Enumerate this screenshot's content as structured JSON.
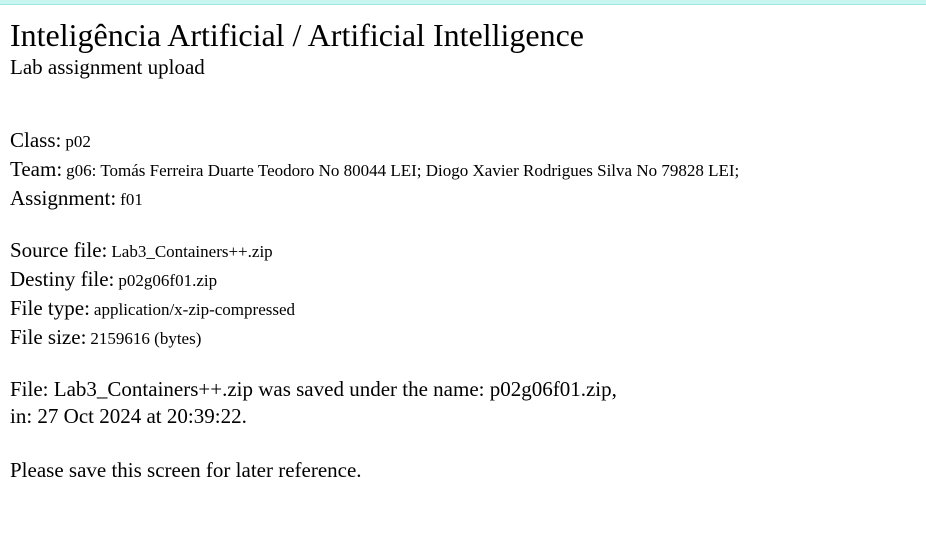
{
  "header": {
    "title": "Inteligência Artificial / Artificial Intelligence",
    "subtitle": "Lab assignment upload"
  },
  "details": {
    "class_label": "Class:",
    "class_value": "p02",
    "team_label": "Team:",
    "team_value": "g06: Tomás Ferreira Duarte Teodoro No 80044 LEI; Diogo Xavier Rodrigues Silva No 79828 LEI;",
    "assignment_label": "Assignment:",
    "assignment_value": "f01"
  },
  "file": {
    "source_label": "Source file:",
    "source_value": "Lab3_Containers++.zip",
    "destiny_label": "Destiny file:",
    "destiny_value": "p02g06f01.zip",
    "type_label": "File type:",
    "type_value": "application/x-zip-compressed",
    "size_label": "File size:",
    "size_value": "2159616 (bytes)"
  },
  "result": {
    "line1": "File: Lab3_Containers++.zip was saved under the name: p02g06f01.zip,",
    "line2": "in: 27 Oct 2024 at 20:39:22."
  },
  "footer": {
    "note": "Please save this screen for later reference."
  }
}
